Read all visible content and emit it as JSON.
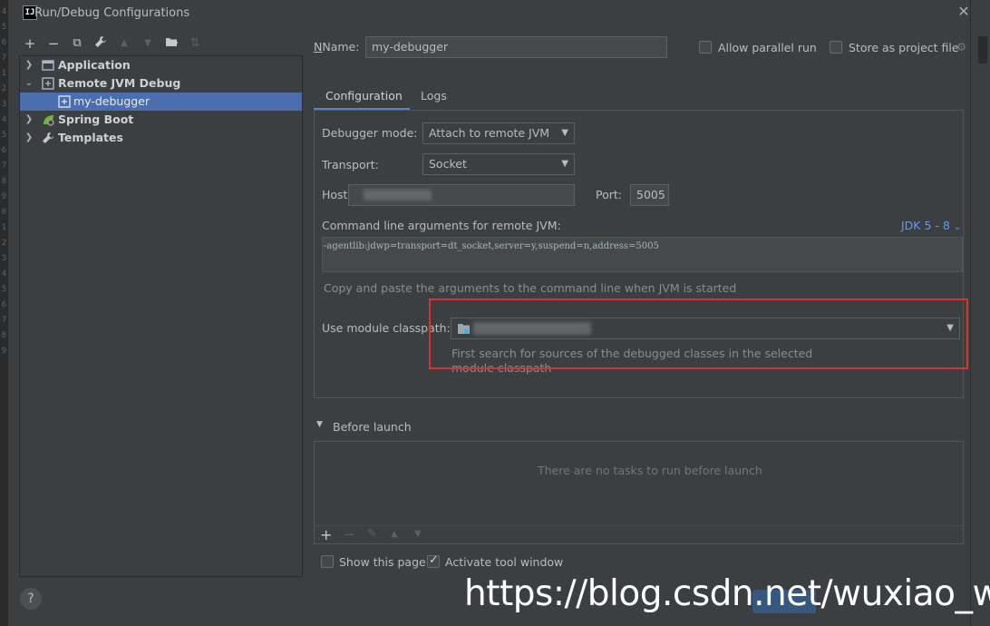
{
  "window": {
    "title": "Run/Debug Configurations",
    "app_icon": "IJ",
    "close_icon": "close-icon"
  },
  "gutter": {
    "numbers": [
      "4",
      "5",
      "6",
      "7",
      "1",
      "2",
      "3",
      "4",
      "5",
      "6",
      "7",
      "8",
      "9",
      "0",
      "1",
      "2",
      "3",
      "4",
      "5",
      "6",
      "7",
      "8",
      "9"
    ]
  },
  "toolbar": {
    "add": "+",
    "remove": "−",
    "copy": "⧉",
    "edit": "🔧",
    "up": "▲",
    "down": "▼",
    "folder": "▣",
    "sort": "⇅"
  },
  "tree": {
    "items": [
      {
        "label": "Application",
        "icon": "application-icon",
        "expanded": false
      },
      {
        "label": "Remote JVM Debug",
        "icon": "remote-debug-icon",
        "expanded": true
      },
      {
        "label": "my-debugger",
        "icon": "debug-config-icon",
        "selected": true
      },
      {
        "label": "Spring Boot",
        "icon": "spring-boot-icon",
        "expanded": false
      },
      {
        "label": "Templates",
        "icon": "wrench-icon",
        "expanded": false
      }
    ]
  },
  "name_field": {
    "label": "Name:",
    "value": "my-debugger"
  },
  "options": {
    "allow_parallel": "Allow parallel run",
    "store_as_project": "Store as project file"
  },
  "tabs": [
    {
      "label": "Configuration",
      "active": true
    },
    {
      "label": "Logs",
      "active": false
    }
  ],
  "config": {
    "debugger_mode_label": "Debugger mode:",
    "debugger_mode_value": "Attach to remote JVM",
    "transport_label": "Transport:",
    "transport_value": "Socket",
    "host_label": "Host:",
    "port_label": "Port:",
    "port_value": "5005",
    "cmdline_label": "Command line arguments for remote JVM:",
    "jdk_link": "JDK 5 - 8",
    "cmdline_value": "-agentlib:jdwp=transport=dt_socket,server=y,suspend=n,address=5005",
    "cmdline_hint": "Copy and paste the arguments to the command line when JVM is started",
    "module_label": "Use module classpath:",
    "module_hint_line1": "First search for sources of the debugged classes in the selected",
    "module_hint_line2": "module classpath"
  },
  "before_launch": {
    "title": "Before launch",
    "empty_text": "There are no tasks to run before launch",
    "toolbar": {
      "add": "+",
      "remove": "−",
      "edit": "✎",
      "up": "▲",
      "down": "▼"
    }
  },
  "bottom": {
    "show_page": "Show this page",
    "activate_tool": "Activate tool window",
    "help": "?"
  },
  "watermark": "https://blog.csdn.net/wuxiao_wei",
  "colors": {
    "background": "#3c3f41",
    "selection": "#4b6eaf",
    "accent_link": "#589df6",
    "annotation_red": "#e0302b"
  }
}
